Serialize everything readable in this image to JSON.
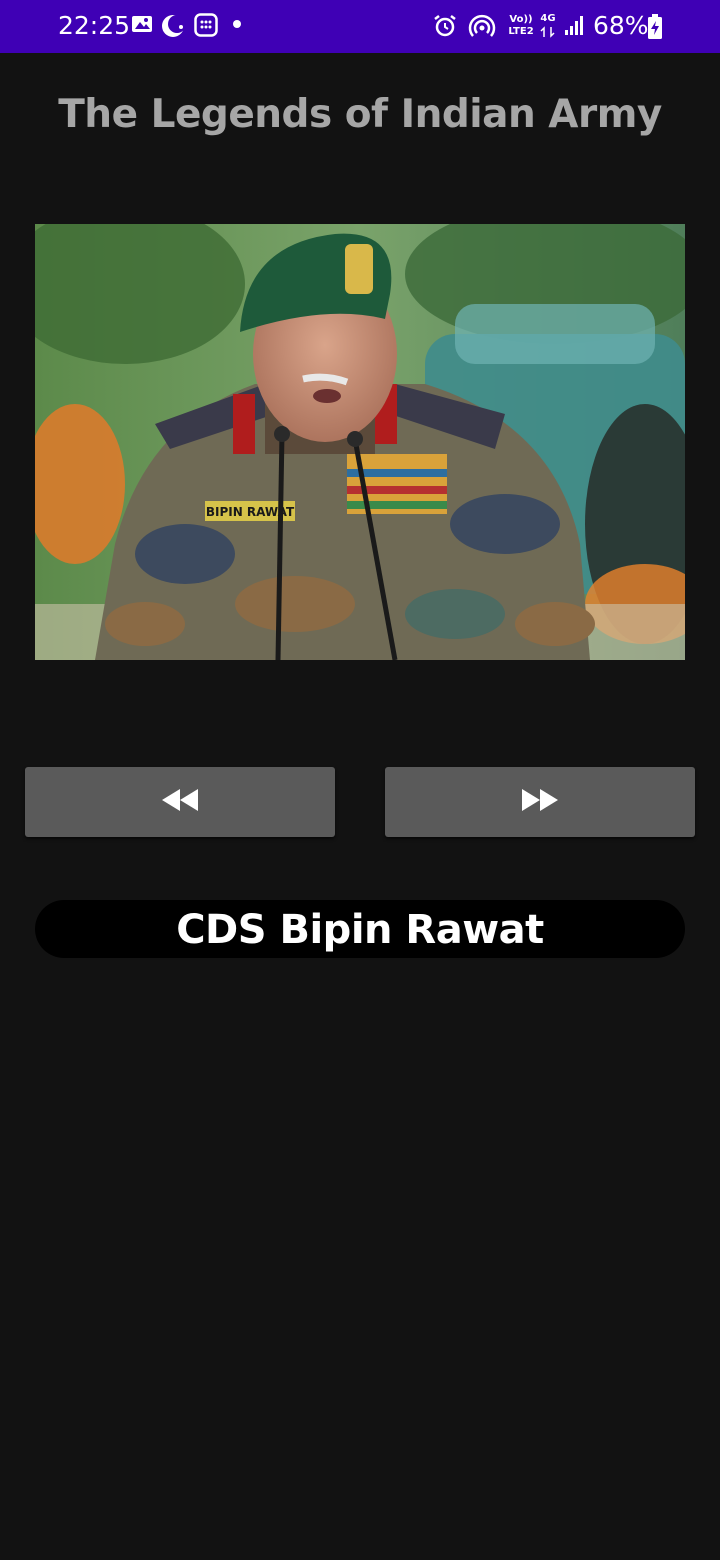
{
  "status_bar": {
    "time": "22:25",
    "network_top": "Vo))",
    "network_bottom": "LTE2",
    "data_type": "4G",
    "battery": "68%",
    "colors": {
      "background": "#3f00b5",
      "foreground": "#ffffff"
    },
    "icons": [
      "gallery-icon",
      "crescent-app-icon",
      "calculator-app-icon",
      "notification-dot-icon",
      "alarm-icon",
      "hotspot-icon",
      "signal-icon",
      "battery-charging-icon"
    ]
  },
  "app": {
    "title": "The Legends of Indian Army",
    "colors": {
      "background": "#121212",
      "title": "#a6a6a6",
      "button": "#5a5a5a",
      "name_pill": "#000000"
    }
  },
  "photo": {
    "description_icon": "portrait-photo"
  },
  "controls": {
    "prev_icon": "rewind-icon",
    "next_icon": "fast-forward-icon"
  },
  "current_legend": {
    "name": "CDS Bipin Rawat"
  }
}
